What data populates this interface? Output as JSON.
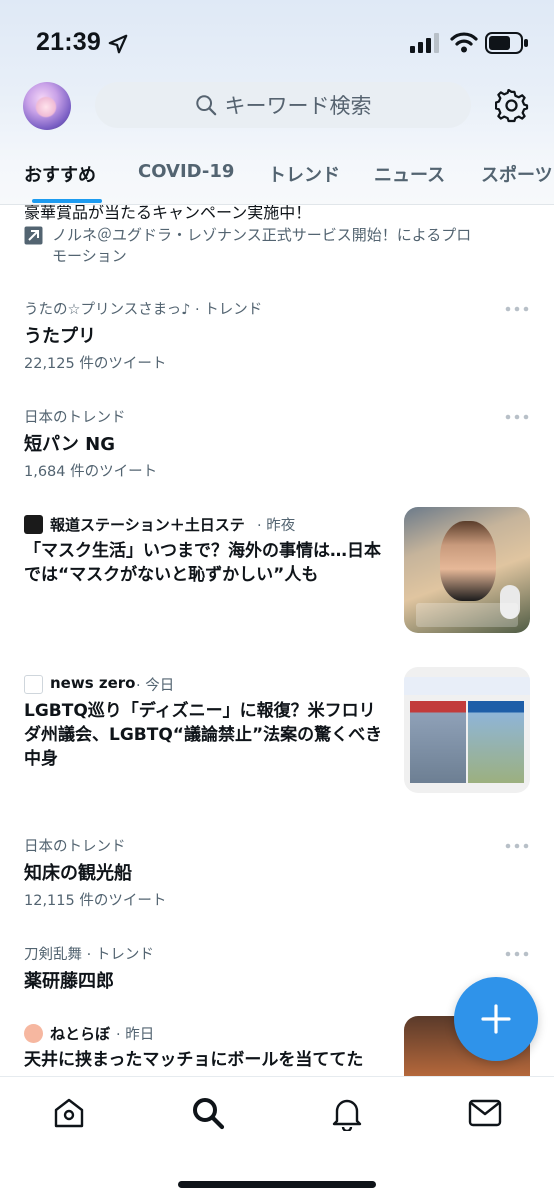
{
  "status_bar": {
    "time": "21:39"
  },
  "header": {
    "search_placeholder": "キーワード検索"
  },
  "tabs": [
    {
      "label": "おすすめ",
      "active": true
    },
    {
      "label": "COVID-19",
      "active": false
    },
    {
      "label": "トレンド",
      "active": false
    },
    {
      "label": "ニュース",
      "active": false
    },
    {
      "label": "スポーツ",
      "active": false
    }
  ],
  "promo": {
    "partial_text": "豪華賞品が当たるキャンペーン実施中！",
    "line": "ノルネ＠ユグドラ・レゾナンス正式サービス開始！によるプロモーション"
  },
  "trends": [
    {
      "context": "うたの☆プリンスさまっ♪ · トレンド",
      "title": "うたプリ",
      "count": "22,125 件のツイート"
    },
    {
      "context": "日本のトレンド",
      "title": "短パン NG",
      "count": "1,684 件のツイート"
    },
    {
      "context": "日本のトレンド",
      "title": "知床の観光船",
      "count": "12,115 件のツイート"
    },
    {
      "context": "刀剣乱舞 · トレンド",
      "title": "薬研藤四郎",
      "count": ""
    }
  ],
  "news": [
    {
      "source": "報道ステーション＋土日ステ",
      "time": "· 昨夜",
      "headline": "「マスク生活」いつまで？海外の事情は…日本では“マスクがないと恥ずかしい”人も",
      "icon_color": "#1a1a1a"
    },
    {
      "source": "news zero",
      "time": "· 今日",
      "headline": "LGBTQ巡り「ディズニー」に報復？米フロリダ州議会、LGBTQ“議論禁止”法案の驚くべき中身",
      "icon_color": "#ffffff"
    },
    {
      "source": "ねとらぼ",
      "time": "· 昨日",
      "headline": "天井に挟まったマッチョにボールを当ててた",
      "icon_color": "#f6b7a0"
    }
  ],
  "colors": {
    "accent": "#1d9bf0",
    "fab": "#2f93ea",
    "text": "#0f1419",
    "secondary": "#536471"
  }
}
